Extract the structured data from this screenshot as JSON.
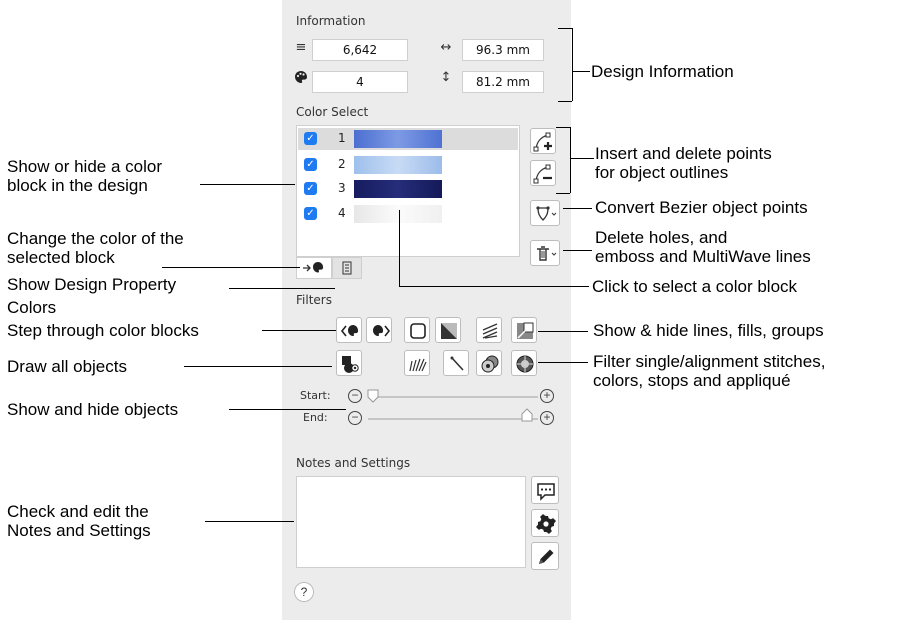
{
  "panel": {
    "information": {
      "title": "Information",
      "stitches_icon": "stitch-count-icon",
      "stitches": "6,642",
      "width_icon": "width-arrows-icon",
      "width": "96.3 mm",
      "colors_icon": "palette-icon",
      "colors": "4",
      "height_icon": "height-arrows-icon",
      "height": "81.2 mm"
    },
    "color_select": {
      "title": "Color Select",
      "items": [
        {
          "number": "1",
          "color": "#5f80d8",
          "checked": true,
          "selected": true
        },
        {
          "number": "2",
          "color": "#a7c6ee",
          "checked": true,
          "selected": false
        },
        {
          "number": "3",
          "color": "#1a2167",
          "checked": true,
          "selected": false
        },
        {
          "number": "4",
          "color": "#f1f1f1",
          "checked": true,
          "selected": false
        }
      ]
    },
    "filters": {
      "title": "Filters",
      "start_label": "Start:",
      "end_label": "End:"
    },
    "notes": {
      "title": "Notes and Settings",
      "value": ""
    },
    "help_label": "?"
  },
  "annotations": {
    "design_information": "Design Information",
    "show_hide_color_block": [
      "Show or hide a color",
      "block in the design"
    ],
    "change_color": [
      "Change the color of the",
      "selected block"
    ],
    "design_property": [
      "Show Design Property",
      "Colors"
    ],
    "step_through": "Step through color blocks",
    "draw_all": "Draw all objects",
    "show_hide_objects": "Show and hide objects",
    "check_edit_notes": [
      "Check and edit the",
      "Notes and Settings"
    ],
    "insert_delete_points": [
      "Insert and delete points",
      "for object outlines"
    ],
    "convert_bezier": "Convert Bezier object points",
    "delete_holes": [
      "Delete holes, and",
      "emboss and MultiWave lines"
    ],
    "click_select": "Click to select a color block",
    "show_hide_lines": "Show & hide lines, fills, groups",
    "filter_single": [
      "Filter single/alignment stitches,",
      "colors, stops and appliqué"
    ]
  }
}
